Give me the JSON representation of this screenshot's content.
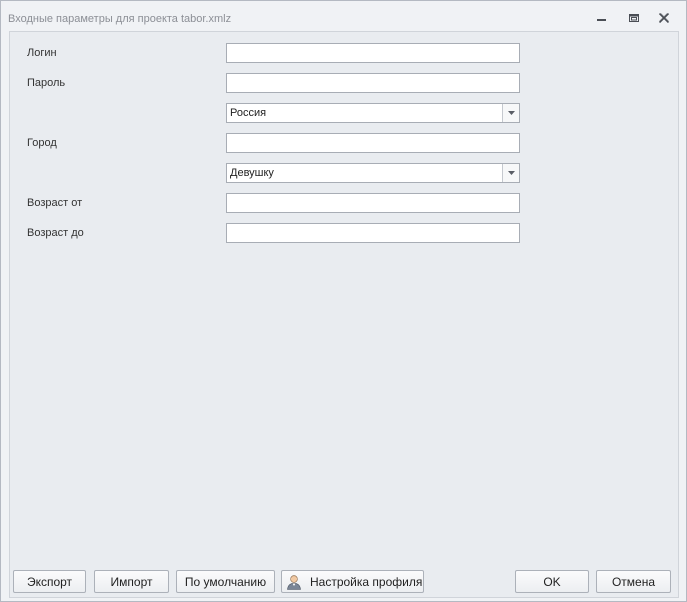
{
  "window": {
    "title": "Входные параметры для проекта tabor.xmlz"
  },
  "form": {
    "login_label": "Логин",
    "login_value": "",
    "password_label": "Пароль",
    "password_value": "",
    "country_value": "Россия",
    "city_label": "Город",
    "city_value": "",
    "gender_value": "Девушку",
    "age_from_label": "Возраст от",
    "age_from_value": "",
    "age_to_label": "Возраст до",
    "age_to_value": ""
  },
  "buttons": {
    "export": "Экспорт",
    "import": "Импорт",
    "default": "По умолчанию",
    "profile": "Настройка профиля",
    "ok": "OK",
    "cancel": "Отмена"
  },
  "icons": {
    "minimize": "minimize-icon",
    "restore": "restore-icon",
    "close": "close-icon",
    "dropdown": "chevron-down-icon",
    "profile": "user-profile-icon"
  },
  "colors": {
    "window_bg": "#f0f2f5",
    "client_bg": "#e9ecf0",
    "title_text": "#8c8f96",
    "input_border": "#a8adb5"
  }
}
